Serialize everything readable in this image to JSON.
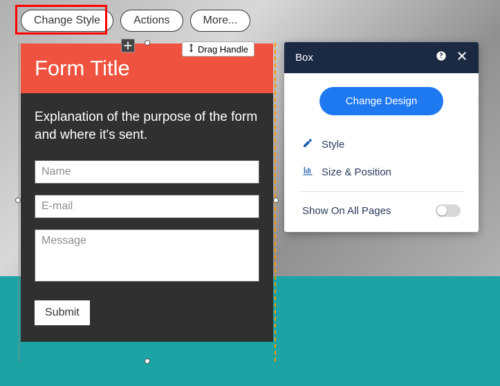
{
  "toolbar": {
    "change_style": "Change Style",
    "actions": "Actions",
    "more": "More..."
  },
  "drag_handle_label": "Drag Handle",
  "form": {
    "title": "Form Title",
    "explanation": "Explanation of the purpose of the form and where it's sent.",
    "name_placeholder": "Name",
    "email_placeholder": "E-mail",
    "message_placeholder": "Message",
    "submit_label": "Submit"
  },
  "popover": {
    "title": "Box",
    "primary_button": "Change Design",
    "style_label": "Style",
    "size_position_label": "Size & Position",
    "show_on_all_pages_label": "Show On All Pages"
  }
}
